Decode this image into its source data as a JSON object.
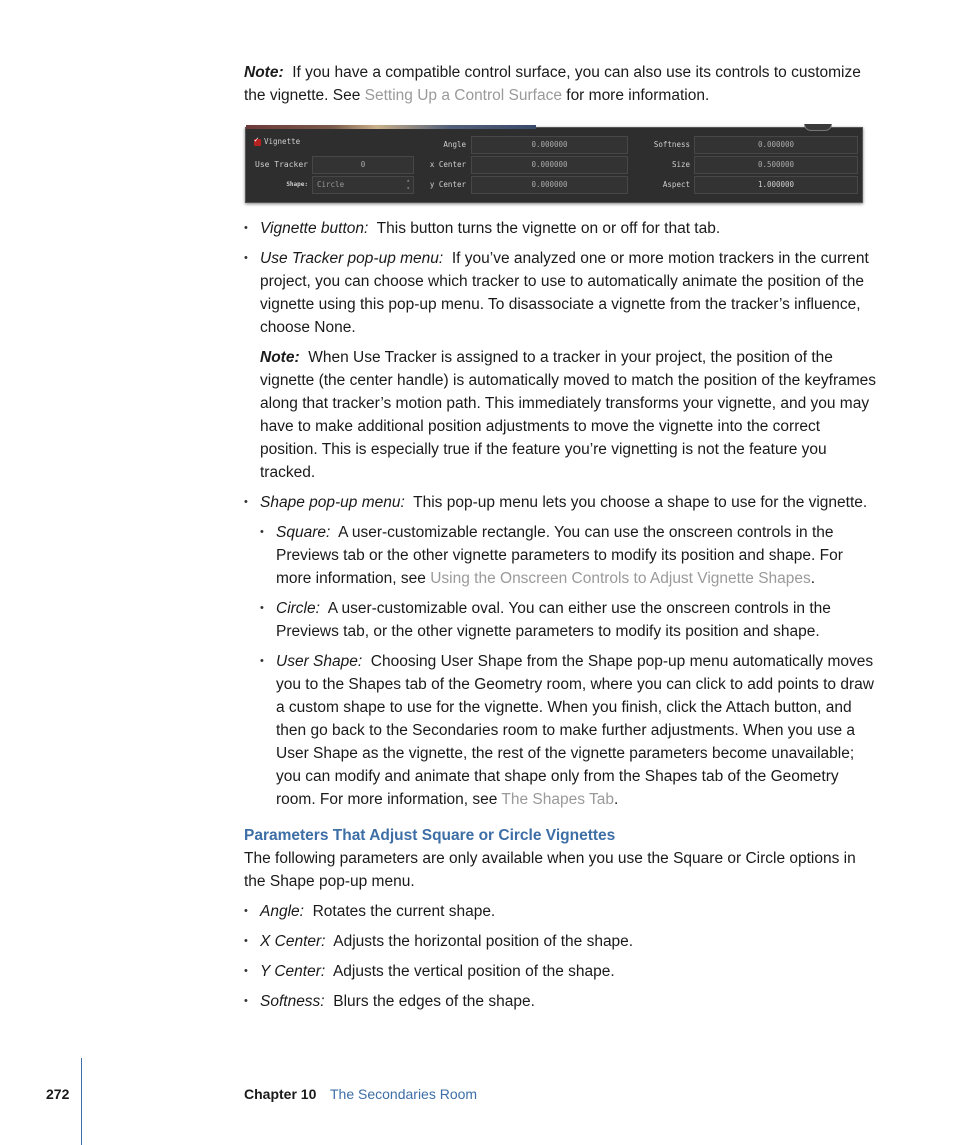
{
  "note_top": {
    "label": "Note:",
    "text_before": "If you have a compatible control surface, you can also use its controls to customize the vignette. See ",
    "link": "Setting Up a Control Surface",
    "text_after": " for more information."
  },
  "vignette_panel": {
    "vignette_label": "Vignette",
    "vignette_enabled": true,
    "use_tracker_label": "Use Tracker",
    "use_tracker_value": "0",
    "shape_label": "Shape:",
    "shape_value": "Circle",
    "angle_label": "Angle",
    "angle_value": "0.000000",
    "x_center_label": "x Center",
    "x_center_value": "0.000000",
    "y_center_label": "y Center",
    "y_center_value": "0.000000",
    "softness_label": "Softness",
    "softness_value": "0.000000",
    "size_label": "Size",
    "size_value": "0.500000",
    "aspect_label": "Aspect",
    "aspect_value": "1.000000"
  },
  "bullets": {
    "vignette_button": {
      "term": "Vignette button:",
      "text": "This button turns the vignette on or off for that tab."
    },
    "use_tracker": {
      "term": "Use Tracker pop-up menu:",
      "text": "If you’ve analyzed one or more motion trackers in the current project, you can choose which tracker to use to automatically animate the position of the vignette using this pop-up menu. To disassociate a vignette from the tracker’s influence, choose None."
    },
    "use_tracker_note": {
      "label": "Note:",
      "text": "When Use Tracker is assigned to a tracker in your project, the position of the vignette (the center handle) is automatically moved to match the position of the keyframes along that tracker’s motion path. This immediately transforms your vignette, and you may have to make additional position adjustments to move the vignette into the correct position. This is especially true if the feature you’re vignetting is not the feature you tracked."
    },
    "shape": {
      "term": "Shape pop-up menu:",
      "text": "This pop-up menu lets you choose a shape to use for the vignette."
    },
    "square": {
      "term": "Square:",
      "text_before": "A user-customizable rectangle. You can use the onscreen controls in the Previews tab or the other vignette parameters to modify its position and shape. For more information, see ",
      "link": "Using the Onscreen Controls to Adjust Vignette Shapes",
      "text_after": "."
    },
    "circle": {
      "term": "Circle:",
      "text": "A user-customizable oval. You can either use the onscreen controls in the Previews tab, or the other vignette parameters to modify its position and shape."
    },
    "user_shape": {
      "term": "User Shape:",
      "text_before": "Choosing User Shape from the Shape pop-up menu automatically moves you to the Shapes tab of the Geometry room, where you can click to add points to draw a custom shape to use for the vignette. When you finish, click the Attach button, and then go back to the Secondaries room to make further adjustments. When you use a User Shape as the vignette, the rest of the vignette parameters become unavailable; you can modify and animate that shape only from the Shapes tab of the Geometry room. For more information, see ",
      "link": "The Shapes Tab",
      "text_after": "."
    }
  },
  "section": {
    "heading": "Parameters That Adjust Square or Circle Vignettes",
    "intro": "The following parameters are only available when you use the Square or Circle options in the Shape pop-up menu.",
    "items": [
      {
        "term": "Angle:",
        "text": "Rotates the current shape."
      },
      {
        "term": "X Center:",
        "text": "Adjusts the horizontal position of the shape."
      },
      {
        "term": "Y Center:",
        "text": "Adjusts the vertical position of the shape."
      },
      {
        "term": "Softness:",
        "text": "Blurs the edges of the shape."
      }
    ]
  },
  "footer": {
    "page_number": "272",
    "chapter": "Chapter 10",
    "chapter_title": "The Secondaries Room"
  },
  "colors": {
    "heading_blue": "#3d6ea6",
    "link_gray": "#9a9a9a"
  }
}
